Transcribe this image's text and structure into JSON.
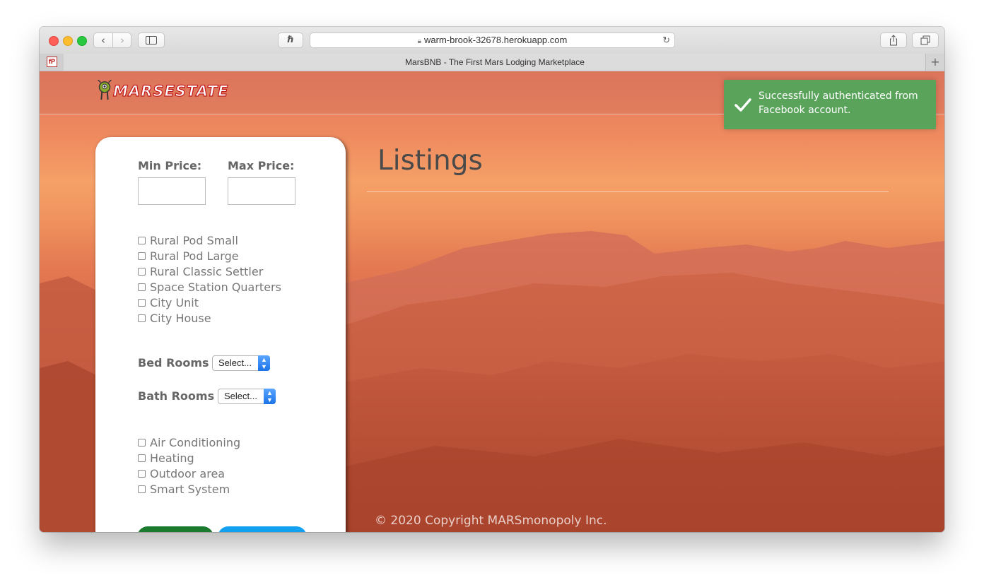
{
  "browser": {
    "url": "warm-brook-32678.herokuapp.com",
    "tab_title": "MarsBNB - The First Mars Lodging Marketplace",
    "pinned_tab_label": "fP"
  },
  "site": {
    "logo_text": "MARSESTATE"
  },
  "filters": {
    "min_price_label": "Min Price:",
    "max_price_label": "Max Price:",
    "min_price_value": "",
    "max_price_value": "",
    "property_types": [
      {
        "label": "Rural Pod Small",
        "checked": false
      },
      {
        "label": "Rural Pod Large",
        "checked": false
      },
      {
        "label": "Rural Classic Settler",
        "checked": false
      },
      {
        "label": "Space Station Quarters",
        "checked": false
      },
      {
        "label": "City Unit",
        "checked": false
      },
      {
        "label": "City House",
        "checked": false
      }
    ],
    "bedrooms_label": "Bed Rooms",
    "bedrooms_value": "Select...",
    "bathrooms_label": "Bath Rooms",
    "bathrooms_value": "Select...",
    "amenities": [
      {
        "label": "Air Conditioning",
        "checked": false
      },
      {
        "label": "Heating",
        "checked": false
      },
      {
        "label": "Outdoor area",
        "checked": false
      },
      {
        "label": "Smart System",
        "checked": false
      }
    ]
  },
  "main": {
    "heading": "Listings",
    "footer": "© 2020 Copyright MARSmonopoly Inc."
  },
  "toast": {
    "message": "Successfully authenticated from Facebook account.",
    "color": "#5aa35b"
  },
  "colors": {
    "logo_red": "#c2181a",
    "search_green": "#1a7a2e",
    "reset_blue": "#12a0f0"
  }
}
